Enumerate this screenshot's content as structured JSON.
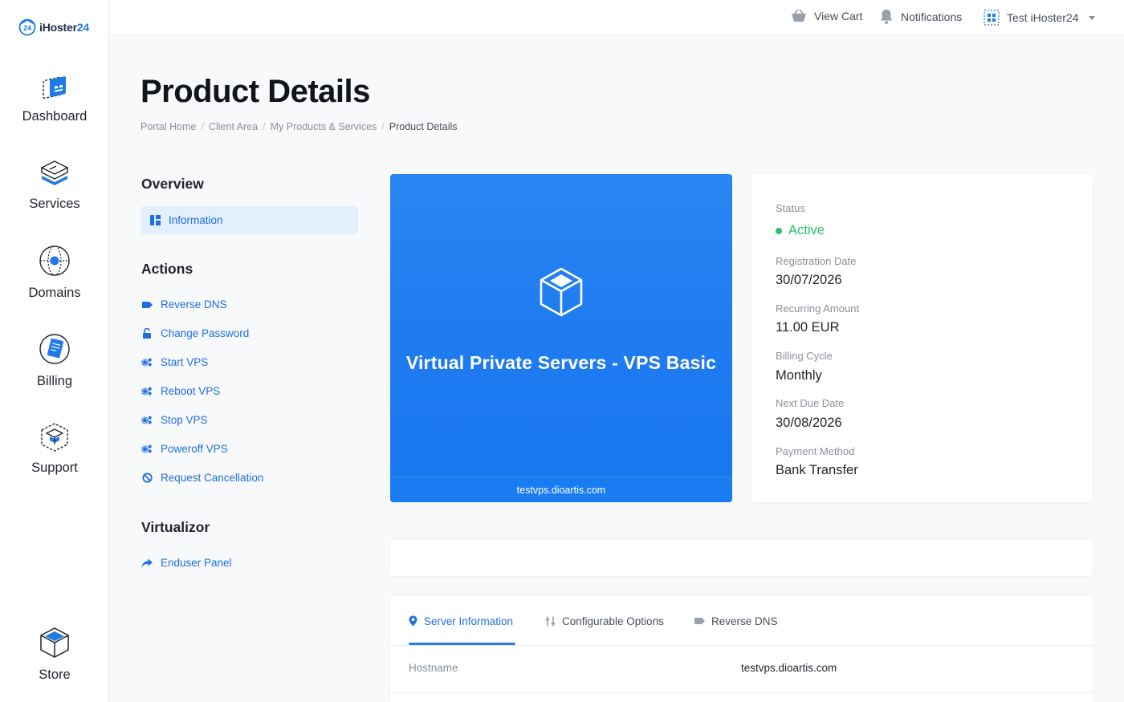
{
  "brand": {
    "logo_prefix": "iHoster",
    "logo_number": "24",
    "logo_badge": "24"
  },
  "sidebar": {
    "items": [
      {
        "label": "Dashboard",
        "icon": "dashboard-icon"
      },
      {
        "label": "Services",
        "icon": "services-icon"
      },
      {
        "label": "Domains",
        "icon": "domains-icon"
      },
      {
        "label": "Billing",
        "icon": "billing-icon"
      },
      {
        "label": "Support",
        "icon": "support-icon"
      },
      {
        "label": "Store",
        "icon": "store-icon"
      }
    ]
  },
  "topbar": {
    "cart_label": "View Cart",
    "notifications_label": "Notifications",
    "user_label": "Test iHoster24"
  },
  "page": {
    "title": "Product Details",
    "breadcrumb": [
      "Portal Home",
      "Client Area",
      "My Products & Services",
      "Product Details"
    ]
  },
  "menu": {
    "overview_heading": "Overview",
    "overview_items": [
      "Information"
    ],
    "actions_heading": "Actions",
    "actions": [
      {
        "label": "Reverse DNS",
        "icon": "tag-icon"
      },
      {
        "label": "Change Password",
        "icon": "lock-icon"
      },
      {
        "label": "Start VPS",
        "icon": "cogs-icon"
      },
      {
        "label": "Reboot VPS",
        "icon": "cogs-icon"
      },
      {
        "label": "Stop VPS",
        "icon": "cogs-icon"
      },
      {
        "label": "Poweroff VPS",
        "icon": "cogs-icon"
      },
      {
        "label": "Request Cancellation",
        "icon": "ban-icon"
      }
    ],
    "virtualizor_heading": "Virtualizor",
    "virtualizor_items": [
      {
        "label": "Enduser Panel",
        "icon": "share-icon"
      }
    ]
  },
  "product": {
    "name": "Virtual Private Servers - VPS Basic",
    "domain": "testvps.dioartis.com"
  },
  "details": {
    "status_label": "Status",
    "status_value": "Active",
    "registration_label": "Registration Date",
    "registration_value": "30/07/2026",
    "recurring_label": "Recurring Amount",
    "recurring_value": "11.00 EUR",
    "cycle_label": "Billing Cycle",
    "cycle_value": "Monthly",
    "due_label": "Next Due Date",
    "due_value": "30/08/2026",
    "payment_label": "Payment Method",
    "payment_value": "Bank Transfer"
  },
  "tabs": {
    "items": [
      {
        "label": "Server Information",
        "icon": "map-marker-icon",
        "active": true
      },
      {
        "label": "Configurable Options",
        "icon": "sliders-icon",
        "active": false
      },
      {
        "label": "Reverse DNS",
        "icon": "tag-icon",
        "active": false
      }
    ],
    "rows": [
      {
        "label": "Hostname",
        "value": "testvps.dioartis.com"
      }
    ]
  },
  "colors": {
    "accent": "#1e7be8",
    "link": "#1e6fe0",
    "active_status": "#27c06b",
    "card_bg": "#1f7cf0"
  }
}
